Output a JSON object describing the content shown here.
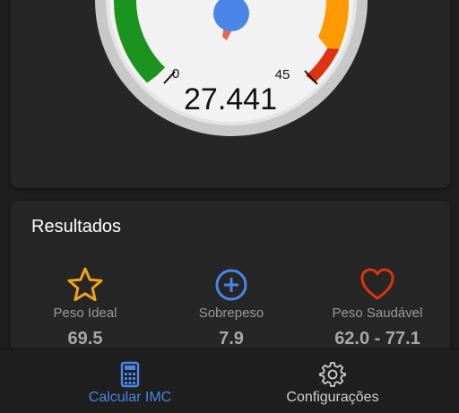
{
  "gauge": {
    "value_text": "27.441",
    "min_label": "0",
    "max_label": "45",
    "value": 27.441,
    "min": 0,
    "max": 45,
    "colors": {
      "underweight": "#1a941e",
      "healthy": "#9e9e9e",
      "overweight": "#ff9a00",
      "obese": "#dd3311",
      "needle_cap": "#4a86e8",
      "needle": "#e8664a"
    }
  },
  "results": {
    "title": "Resultados",
    "metrics": [
      {
        "label": "Peso Ideal",
        "value": "69.5",
        "icon": "star-icon",
        "color": "#f0a21b"
      },
      {
        "label": "Sobrepeso",
        "value": "7.9",
        "icon": "plus-circle-icon",
        "color": "#4a86e8"
      },
      {
        "label": "Peso Saudável",
        "value": "62.0 - 77.1",
        "icon": "heart-icon",
        "color": "#dd3311"
      }
    ]
  },
  "nav": {
    "items": [
      {
        "label": "Calcular IMC",
        "icon": "calculator-icon",
        "active": true,
        "color": "#4a86e8"
      },
      {
        "label": "Configurações",
        "icon": "gear-icon",
        "active": false,
        "color": "#cfcfcf"
      }
    ]
  }
}
